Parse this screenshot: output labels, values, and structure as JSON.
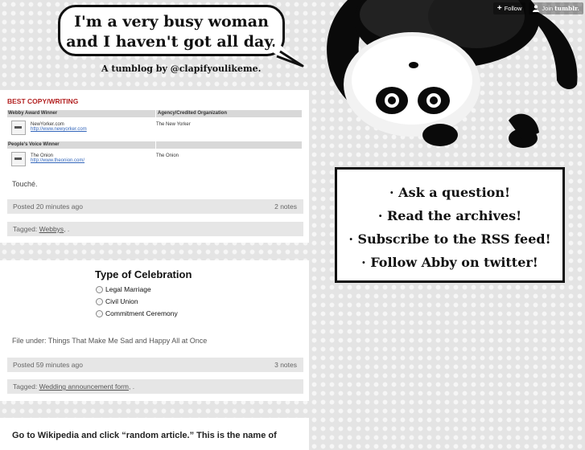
{
  "header": {
    "title_line1": "I'm a very busy woman",
    "title_line2": "and I haven't got all day.",
    "tagline": "A tumblog by @clapifyoulikeme."
  },
  "tumblr_bar": {
    "follow_label": "Follow",
    "join_label": "Join",
    "brand": "tumblr."
  },
  "post1": {
    "heading": "BEST COPY/WRITING",
    "col1_header": "Webby Award Winner",
    "col2_header": "Agency/Credited Organization",
    "row1": {
      "name": "NewYorker.com",
      "url": "http://www.newyorker.com",
      "org": "The New Yorker"
    },
    "section2_header": "People's Voice Winner",
    "row2": {
      "name": "The Onion",
      "url": "http://www.theonion.com/",
      "org": "The Onion"
    },
    "caption": "Touché.",
    "posted": "Posted 20 minutes ago",
    "notes": "2 notes",
    "tagged_prefix": "Tagged:",
    "tag": "Webbys",
    "tag_suffix": ", ."
  },
  "post2": {
    "form_title": "Type of Celebration",
    "options": [
      "Legal Marriage",
      "Civil Union",
      "Commitment Ceremony"
    ],
    "file_under": "File under: Things That Make Me Sad and Happy All at Once",
    "posted": "Posted 59 minutes ago",
    "notes": "3 notes",
    "tagged_prefix": "Tagged:",
    "tag": "Wedding announcement form",
    "tag_suffix": ", ."
  },
  "post3": {
    "text": "Go to Wikipedia and click “random article.” This is the name of"
  },
  "sidebar": {
    "links": [
      "· Ask a question!",
      "· Read the archives!",
      "· Subscribe to the RSS feed!",
      "· Follow Abby on twitter!"
    ]
  }
}
